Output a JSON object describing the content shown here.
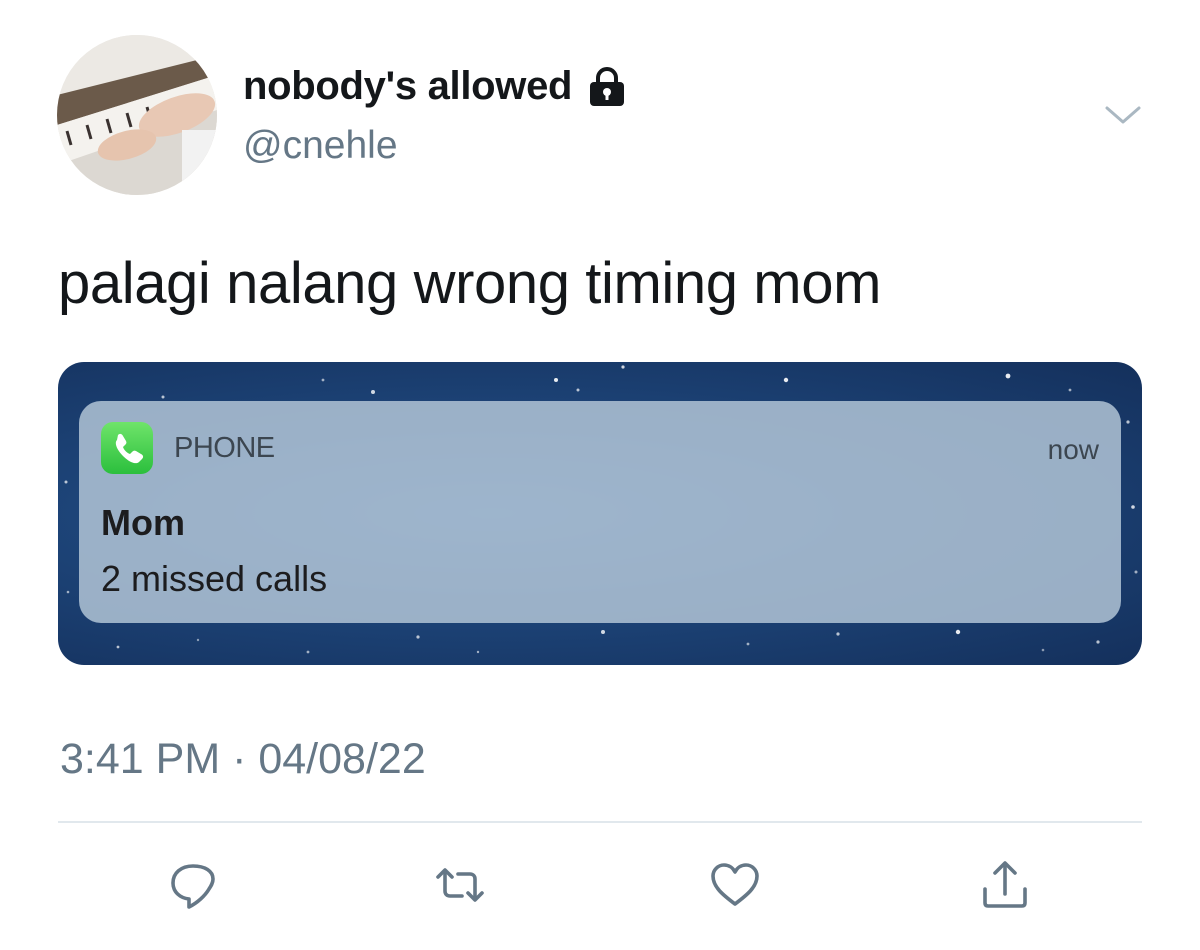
{
  "author": {
    "display_name": "nobody's allowed",
    "handle": "@cnehle",
    "avatar_icon": "piano-photo-avatar",
    "protected_icon": "lock-icon"
  },
  "tweet": {
    "text": "palagi nalang wrong timing mom",
    "timestamp": "3:41 PM · 04/08/22"
  },
  "notification": {
    "app_name": "PHONE",
    "time": "now",
    "title": "Mom",
    "body": "2 missed calls",
    "app_icon": "phone-icon"
  },
  "actions": [
    {
      "name": "reply",
      "icon": "reply-icon"
    },
    {
      "name": "retweet",
      "icon": "retweet-icon"
    },
    {
      "name": "like",
      "icon": "heart-icon"
    },
    {
      "name": "share",
      "icon": "share-icon"
    }
  ],
  "colors": {
    "text": "#14171a",
    "muted": "#657786",
    "divider": "#e1e8ed",
    "phone_green": "#34c759"
  }
}
